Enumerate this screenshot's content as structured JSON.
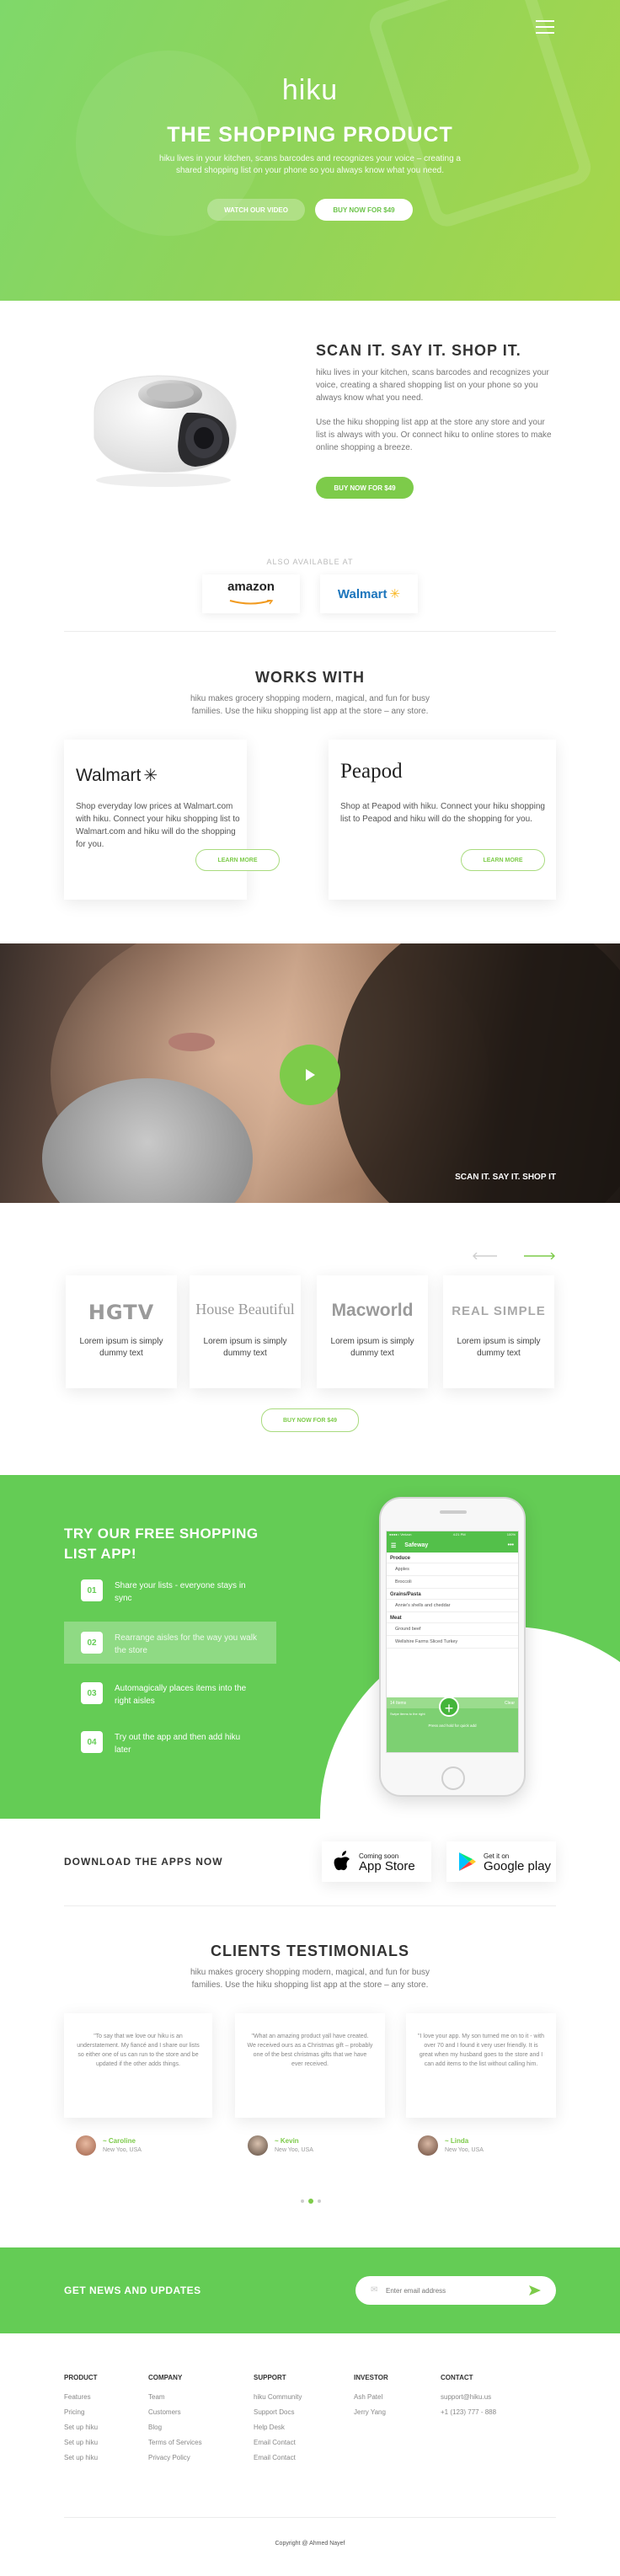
{
  "hero": {
    "logo": "hiku",
    "title": "THE SHOPPING PRODUCT",
    "subtitle": "hiku lives in your kitchen, scans barcodes and recognizes your voice – creating a shared shopping list on your phone so you always know what you need.",
    "watch_label": "WATCH OUR VIDEO",
    "buy_label": "BUY NOW FOR $49"
  },
  "scan": {
    "title": "SCAN IT. SAY IT. SHOP IT.",
    "p1": "hiku lives in your kitchen, scans barcodes and recognizes your voice, creating a shared shopping list on your phone so you always know what you need.",
    "p2": "Use the hiku shopping list app at the store any store and your list is always with you. Or connect hiku to online stores to make online shopping a breeze.",
    "buy_label": "BUY NOW FOR $49"
  },
  "also": {
    "label": "ALSO AVAILABLE AT",
    "stores": [
      "amazon",
      "Walmart"
    ]
  },
  "works": {
    "title": "WORKS WITH",
    "subtitle": "hiku makes grocery shopping modern, magical, and fun for busy families. Use the hiku shopping list app at the store – any store.",
    "cards": [
      {
        "brand": "Walmart",
        "text": "Shop everyday low prices at Walmart.com with hiku. Connect your hiku shopping list to Walmart.com and hiku will do the shopping for you.",
        "button": "LEARN MORE"
      },
      {
        "brand": "Peapod",
        "text": "Shop at Peapod with hiku. Connect your hiku shopping list to Peapod and hiku will do the shopping for you.",
        "button": "LEARN MORE"
      }
    ]
  },
  "video": {
    "caption": "SCAN IT. SAY IT. SHOP IT"
  },
  "press": {
    "items": [
      {
        "brand": "HGTV",
        "text": "Lorem ipsum is simply dummy text"
      },
      {
        "brand": "House Beautiful",
        "text": "Lorem ipsum is simply dummy text"
      },
      {
        "brand": "Macworld",
        "text": "Lorem ipsum is simply dummy text"
      },
      {
        "brand": "REAL SIMPLE",
        "text": "Lorem ipsum is simply dummy text"
      }
    ],
    "buy_label": "BUY NOW FOR $49"
  },
  "app": {
    "title": "TRY OUR FREE SHOPPING LIST APP!",
    "steps": [
      {
        "num": "01",
        "text": "Share your lists - everyone stays in sync"
      },
      {
        "num": "02",
        "text": "Rearrange aisles for the way you walk the store"
      },
      {
        "num": "03",
        "text": "Automagically places items into the right aisles"
      },
      {
        "num": "04",
        "text": "Try out the app and then add hiku later"
      }
    ],
    "phone": {
      "status_left": "●●●●○ Verizon",
      "status_time": "4:21 PM",
      "status_right": "100%",
      "store": "Safeway",
      "sections": [
        {
          "name": "Produce",
          "items": [
            "Apples",
            "Broccoli"
          ]
        },
        {
          "name": "Grains/Pasta",
          "items": [
            "Annie's shells and cheddar"
          ]
        },
        {
          "name": "Meat",
          "items": [
            "Ground beef",
            "Wellshire Farms Sliced Turkey"
          ]
        }
      ],
      "footer_count": "14 Items",
      "footer_clear": "Clear",
      "hint": "Swipe items to the right",
      "tip": "Press and hold for quick add"
    }
  },
  "download": {
    "title": "DOWNLOAD THE APPS NOW",
    "apple_small": "Coming soon",
    "apple_big": "App Store",
    "google_small": "Get it on",
    "google_big": "Google play"
  },
  "testimonials": {
    "title": "CLIENTS TESTIMONIALS",
    "subtitle": "hiku makes grocery shopping modern, magical, and fun for busy families. Use the hiku shopping list app at the store – any store.",
    "items": [
      {
        "quote": "\"To say that we love our hiku is an understatement. My fiancé and I share our lists so either one of us can run to the store and be updated if the other adds things.",
        "name": "~ Caroline",
        "location": "New Yoo, USA"
      },
      {
        "quote": "\"What an amazing product yall have created. We received ours as a Christmas gift – probably one of the best christmas gifts that we have ever received.",
        "name": "~ Kevin",
        "location": "New Yoo, USA"
      },
      {
        "quote": "\"I love your app. My son turned me on to it - with over 70 and I found it very user friendly. It is great when my husband goes to the store and I can add items to the list without calling him.",
        "name": "~ Linda",
        "location": "New Yoo, USA"
      }
    ]
  },
  "news": {
    "title": "GET NEWS AND UPDATES",
    "placeholder": "Enter email address"
  },
  "footer": {
    "columns": [
      {
        "title": "PRODUCT",
        "links": [
          "Features",
          "Pricing",
          "Set up hiku",
          "Set up hiku",
          "Set up hiku"
        ]
      },
      {
        "title": "COMPANY",
        "links": [
          "Team",
          "Customers",
          "Blog",
          "Terms of Services",
          "Privacy Policy"
        ]
      },
      {
        "title": "SUPPORT",
        "links": [
          "hiku Community",
          "Support Docs",
          "Help Desk",
          "Email Contact",
          "Email Contact"
        ]
      },
      {
        "title": "INVESTOR",
        "links": [
          "Ash Patel",
          "Jerry Yang"
        ]
      },
      {
        "title": "CONTACT",
        "links": [
          "support@hiku.us",
          "+1 (123) 777 - 888"
        ]
      }
    ],
    "copyright": "Copyright @ Ahmed Nayef"
  },
  "colors": {
    "accent": "#64cc55",
    "accent_light": "#7dcb4a",
    "text_dark": "#333333"
  }
}
